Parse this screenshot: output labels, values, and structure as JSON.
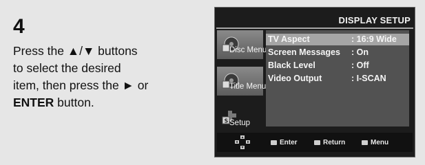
{
  "step": {
    "number": "4",
    "line1": "Press the ▲/▼ buttons",
    "line2": "to select the desired",
    "line3": "item, then press the ► or",
    "line4_bold": "ENTER",
    "line4_rest": " button."
  },
  "osd": {
    "title": "DISPLAY SETUP",
    "side_tabs": [
      {
        "label": "Disc Menu",
        "icon": "disc-icon"
      },
      {
        "label": "Title Menu",
        "icon": "title-icon"
      },
      {
        "label": "Setup",
        "icon": "setup-icon"
      }
    ],
    "rows": [
      {
        "key": "TV Aspect",
        "value": ": 16:9 Wide",
        "selected": true
      },
      {
        "key": "Screen Messages",
        "value": ": On",
        "selected": false
      },
      {
        "key": "Black Level",
        "value": ": Off",
        "selected": false
      },
      {
        "key": "Video Output",
        "value": ": I-SCAN",
        "selected": false
      }
    ],
    "hints": {
      "enter": "Enter",
      "return": "Return",
      "menu": "Menu"
    }
  }
}
